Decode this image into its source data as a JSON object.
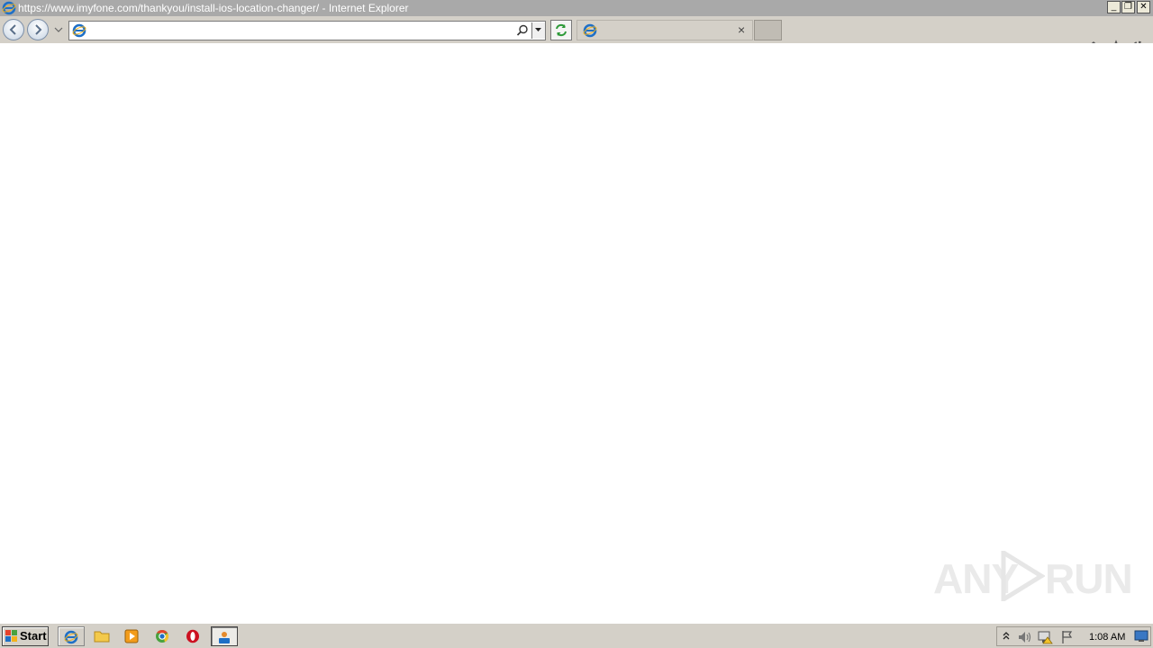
{
  "window": {
    "title": "https://www.imyfone.com/thankyou/install-ios-location-changer/ - Internet Explorer",
    "controls": {
      "minimize": "_",
      "restore": "❐",
      "close": "✕"
    }
  },
  "toolbar": {
    "address_value": "",
    "tab_title": "",
    "tab_close": "×"
  },
  "watermark": {
    "left": "ANY",
    "right": "RUN"
  },
  "taskbar": {
    "start_label": "Start",
    "apps": [
      "internet-explorer",
      "file-explorer",
      "media-player",
      "chrome",
      "opera",
      "active-app"
    ],
    "clock": "1:08 AM"
  },
  "colors": {
    "titlebar": "#a9a9a9",
    "chrome": "#d4d0c8",
    "ie_blue": "#1e6fc6",
    "ie_ring": "#f3b21b"
  }
}
